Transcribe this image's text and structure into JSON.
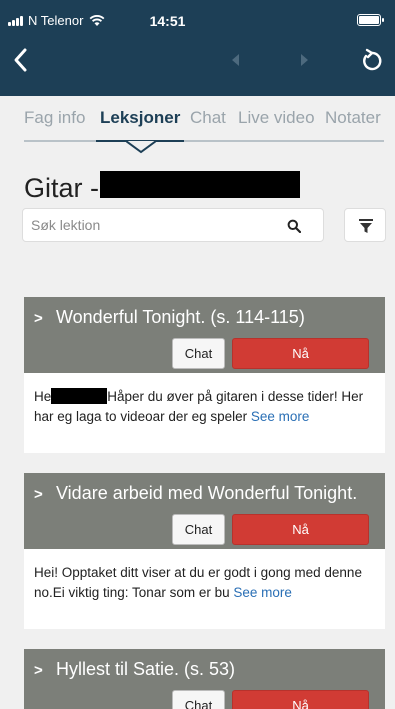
{
  "status_bar": {
    "carrier": "N Telenor",
    "time": "14:51"
  },
  "tabs": [
    {
      "label": "Fag info",
      "active": false
    },
    {
      "label": "Leksjoner",
      "active": true
    },
    {
      "label": "Chat",
      "active": false
    },
    {
      "label": "Live video",
      "active": false
    },
    {
      "label": "Notater",
      "active": false
    }
  ],
  "course": {
    "title": "Gitar -"
  },
  "search": {
    "placeholder": "Søk lektion"
  },
  "lessons": [
    {
      "title": "Wonderful Tonight. (s. 114-115)",
      "chat_label": "Chat",
      "now_label": "Nå",
      "text_prefix": "He",
      "text_rest": "Håper du øver på gitaren i desse tider! Her har eg laga to videoar der eg speler",
      "see_more": "See more"
    },
    {
      "title": "Vidare arbeid med Wonderful Tonight.",
      "chat_label": "Chat",
      "now_label": "Nå",
      "text_prefix": "",
      "text_rest": "Hei! Opptaket ditt viser at du er godt i gong med denne no.Ei viktig ting: Tonar som er bu",
      "see_more": "See more"
    },
    {
      "title": "Hyllest til Satie. (s. 53)",
      "chat_label": "Chat",
      "now_label": "Nå"
    }
  ],
  "colors": {
    "header_bg": "#1d3f56",
    "card_header_bg": "#7c7f79",
    "now_button": "#d13b34",
    "link": "#2a6fb5"
  }
}
